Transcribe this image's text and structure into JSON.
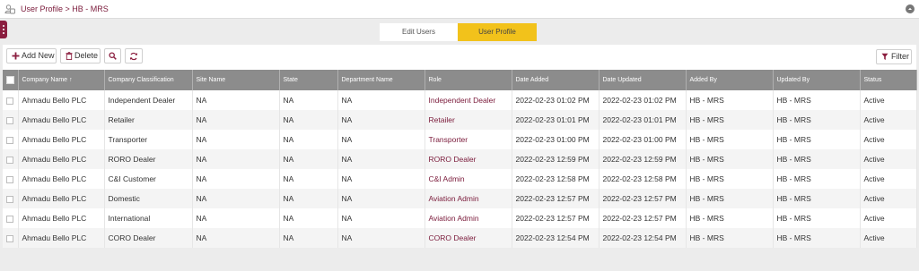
{
  "breadcrumb": "User Profile > HB - MRS",
  "tabs": {
    "edit_users": "Edit Users",
    "user_profile": "User Profile"
  },
  "toolbar": {
    "add_new_label": "Add New",
    "delete_label": "Delete",
    "filter_label": "Filter"
  },
  "colors": {
    "brand": "#8b1e3f",
    "active_tab": "#f2c21b",
    "header_bg": "#8c8c8c"
  },
  "table": {
    "columns": [
      "Company Name",
      "Company Classification",
      "Site Name",
      "State",
      "Department Name",
      "Role",
      "Date Added",
      "Date Updated",
      "Added By",
      "Updated By",
      "Status"
    ],
    "sort_indicator": "↑",
    "rows": [
      {
        "company": "Ahmadu Bello PLC",
        "classification": "Independent Dealer",
        "site": "NA",
        "state": "NA",
        "department": "NA",
        "role": "Independent Dealer",
        "date_added": "2022-02-23 01:02 PM",
        "date_updated": "2022-02-23 01:02 PM",
        "added_by": "HB - MRS",
        "updated_by": "HB - MRS",
        "status": "Active"
      },
      {
        "company": "Ahmadu Bello PLC",
        "classification": "Retailer",
        "site": "NA",
        "state": "NA",
        "department": "NA",
        "role": "Retailer",
        "date_added": "2022-02-23 01:01 PM",
        "date_updated": "2022-02-23 01:01 PM",
        "added_by": "HB - MRS",
        "updated_by": "HB - MRS",
        "status": "Active"
      },
      {
        "company": "Ahmadu Bello PLC",
        "classification": "Transporter",
        "site": "NA",
        "state": "NA",
        "department": "NA",
        "role": "Transporter",
        "date_added": "2022-02-23 01:00 PM",
        "date_updated": "2022-02-23 01:00 PM",
        "added_by": "HB - MRS",
        "updated_by": "HB - MRS",
        "status": "Active"
      },
      {
        "company": "Ahmadu Bello PLC",
        "classification": "RORO Dealer",
        "site": "NA",
        "state": "NA",
        "department": "NA",
        "role": "RORO Dealer",
        "date_added": "2022-02-23 12:59 PM",
        "date_updated": "2022-02-23 12:59 PM",
        "added_by": "HB - MRS",
        "updated_by": "HB - MRS",
        "status": "Active"
      },
      {
        "company": "Ahmadu Bello PLC",
        "classification": "C&I Customer",
        "site": "NA",
        "state": "NA",
        "department": "NA",
        "role": "C&I Admin",
        "date_added": "2022-02-23 12:58 PM",
        "date_updated": "2022-02-23 12:58 PM",
        "added_by": "HB - MRS",
        "updated_by": "HB - MRS",
        "status": "Active"
      },
      {
        "company": "Ahmadu Bello PLC",
        "classification": "Domestic",
        "site": "NA",
        "state": "NA",
        "department": "NA",
        "role": "Aviation Admin",
        "date_added": "2022-02-23 12:57 PM",
        "date_updated": "2022-02-23 12:57 PM",
        "added_by": "HB - MRS",
        "updated_by": "HB - MRS",
        "status": "Active"
      },
      {
        "company": "Ahmadu Bello PLC",
        "classification": "International",
        "site": "NA",
        "state": "NA",
        "department": "NA",
        "role": "Aviation Admin",
        "date_added": "2022-02-23 12:57 PM",
        "date_updated": "2022-02-23 12:57 PM",
        "added_by": "HB - MRS",
        "updated_by": "HB - MRS",
        "status": "Active"
      },
      {
        "company": "Ahmadu Bello PLC",
        "classification": "CORO Dealer",
        "site": "NA",
        "state": "NA",
        "department": "NA",
        "role": "CORO Dealer",
        "date_added": "2022-02-23 12:54 PM",
        "date_updated": "2022-02-23 12:54 PM",
        "added_by": "HB - MRS",
        "updated_by": "HB - MRS",
        "status": "Active"
      }
    ]
  }
}
